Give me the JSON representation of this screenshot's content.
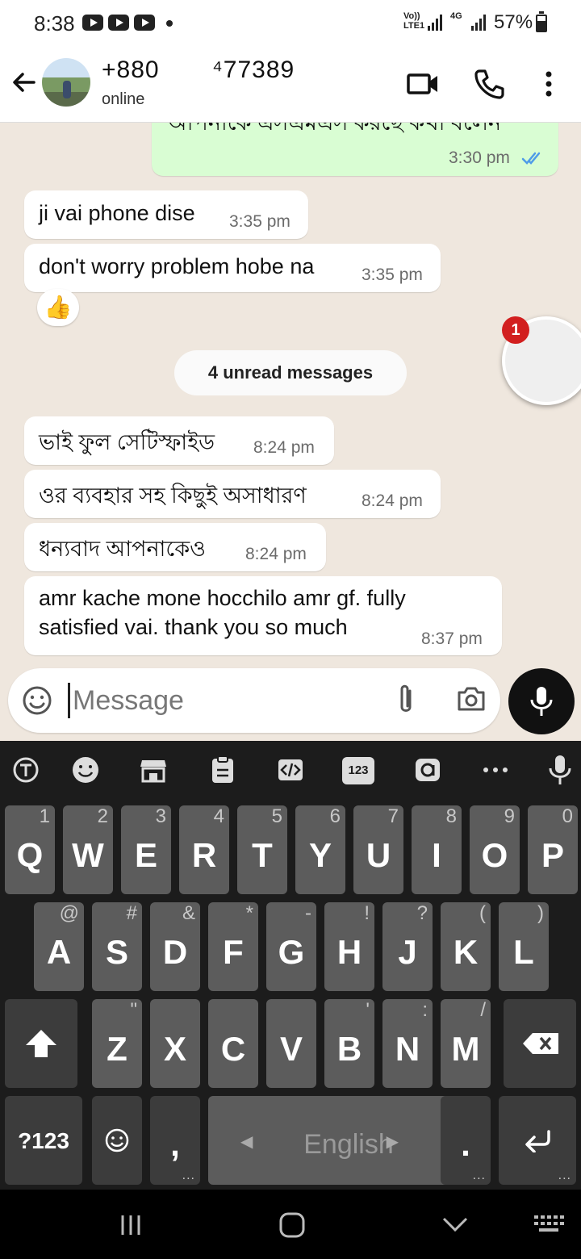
{
  "status_bar": {
    "time": "8:38",
    "volte": "Vo)) LTE1",
    "network": "4G",
    "battery": "57%"
  },
  "header": {
    "contact": "+880       ⁴77389",
    "status": "online"
  },
  "messages": [
    {
      "text": "আপনাকে এসএমএস করছে কথা বলেন",
      "time": "3:30 pm",
      "direction": "out",
      "status": "read"
    },
    {
      "text": "ji vai phone dise",
      "time": "3:35 pm",
      "direction": "in"
    },
    {
      "text": "don't worry problem hobe na",
      "time": "3:35 pm",
      "direction": "in",
      "reaction": "👍"
    },
    {
      "text": "ভাই ফুল সেটিস্ফাইড",
      "time": "8:24 pm",
      "direction": "in"
    },
    {
      "text": "ওর ব্যবহার সহ কিছুই অসাধারণ",
      "time": "8:24 pm",
      "direction": "in"
    },
    {
      "text": "ধন্যবাদ আপনাকেও",
      "time": "8:24 pm",
      "direction": "in"
    },
    {
      "text": "amr kache mone hocchilo amr gf. fully",
      "text_line2": "satisfied vai. thank you so much",
      "time": "8:37 pm",
      "direction": "in"
    }
  ],
  "unread_divider": "4 unread messages",
  "chat_head_badge": "1",
  "composer": {
    "placeholder": "Message"
  },
  "keyboard": {
    "toolbar_icons": [
      "translate-icon",
      "emoji-icon",
      "sticker-store-icon",
      "clipboard-icon",
      "code-icon",
      "numpad-icon",
      "grammar-icon",
      "more-icon",
      "voice-input-icon"
    ],
    "numpad_label": "123",
    "row1": [
      {
        "key": "Q",
        "hint": "1"
      },
      {
        "key": "W",
        "hint": "2"
      },
      {
        "key": "E",
        "hint": "3"
      },
      {
        "key": "R",
        "hint": "4"
      },
      {
        "key": "T",
        "hint": "5"
      },
      {
        "key": "Y",
        "hint": "6"
      },
      {
        "key": "U",
        "hint": "7"
      },
      {
        "key": "I",
        "hint": "8"
      },
      {
        "key": "O",
        "hint": "9"
      },
      {
        "key": "P",
        "hint": "0"
      }
    ],
    "row2": [
      {
        "key": "A",
        "hint": "@"
      },
      {
        "key": "S",
        "hint": "#"
      },
      {
        "key": "D",
        "hint": "&"
      },
      {
        "key": "F",
        "hint": "*"
      },
      {
        "key": "G",
        "hint": "-"
      },
      {
        "key": "H",
        "hint": "!"
      },
      {
        "key": "J",
        "hint": "?"
      },
      {
        "key": "K",
        "hint": "("
      },
      {
        "key": "L",
        "hint": ")"
      }
    ],
    "row3": [
      {
        "key": "Z",
        "hint": "\""
      },
      {
        "key": "X",
        "hint": ""
      },
      {
        "key": "C",
        "hint": ""
      },
      {
        "key": "V",
        "hint": ""
      },
      {
        "key": "B",
        "hint": "'"
      },
      {
        "key": "N",
        "hint": ":"
      },
      {
        "key": "M",
        "hint": "/"
      }
    ],
    "symbols_key": "?123",
    "comma": ",",
    "space_label": "English",
    "period": "."
  }
}
